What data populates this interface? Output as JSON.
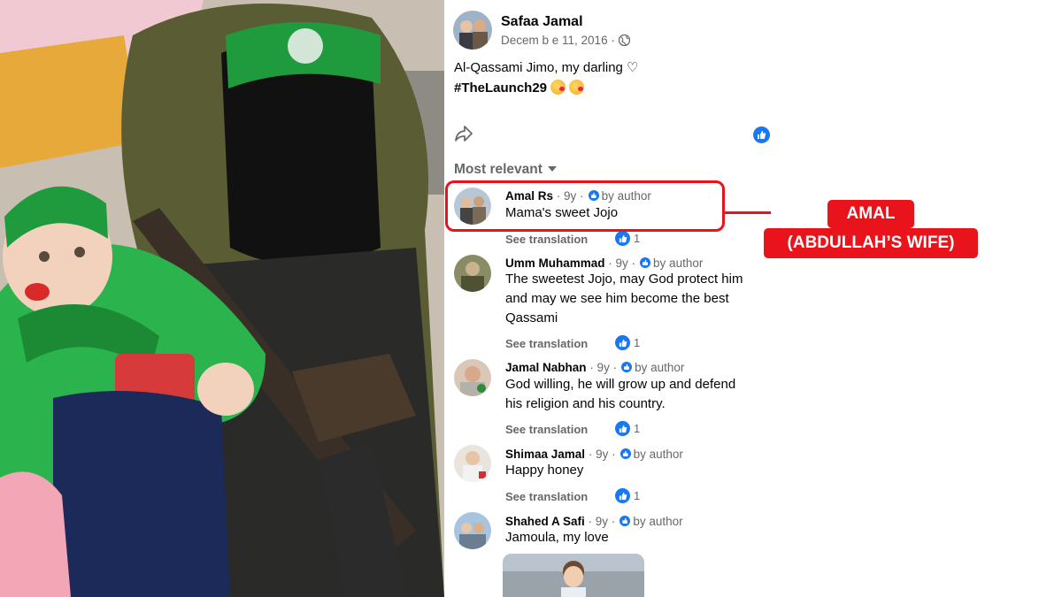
{
  "post": {
    "author": "Safaa Jamal",
    "date": "Decem b e 11, 2016 ·",
    "text_line1": "Al-Qassami Jimo, my darling ♡",
    "hashtag": "#TheLaunch29",
    "sort_label": "Most relevant"
  },
  "comments": [
    {
      "name": "Amal Rs",
      "meta": "· 9y ·",
      "badge": "by author",
      "text": "Mama's sweet Jojo",
      "see_translation": "See translation",
      "likes": "1"
    },
    {
      "name": "Umm Muhammad",
      "meta": "· 9y ·",
      "badge": "by author",
      "text": "The sweetest Jojo, may God protect him and may we see him become the best Qassami",
      "see_translation": "See translation",
      "likes": "1"
    },
    {
      "name": "Jamal Nabhan",
      "meta": "· 9y ·",
      "badge": "by author",
      "text": "God willing, he will grow up and defend his religion and his country.",
      "see_translation": "See translation",
      "likes": "1"
    },
    {
      "name": "Shimaa Jamal",
      "meta": "· 9y ·",
      "badge": "by author",
      "text": "Happy honey",
      "see_translation": "See translation",
      "likes": "1"
    },
    {
      "name": "Shahed A Safi",
      "meta": "· 9y ·",
      "badge": "by author",
      "text": "Jamoula, my love"
    }
  ],
  "annotation": {
    "line1": "AMAL",
    "line2": "(ABDULLAH’S WIFE)",
    "color": "#e8131b"
  },
  "colors": {
    "facebook_blue": "#1877f2",
    "secondary_text": "#65676b"
  }
}
